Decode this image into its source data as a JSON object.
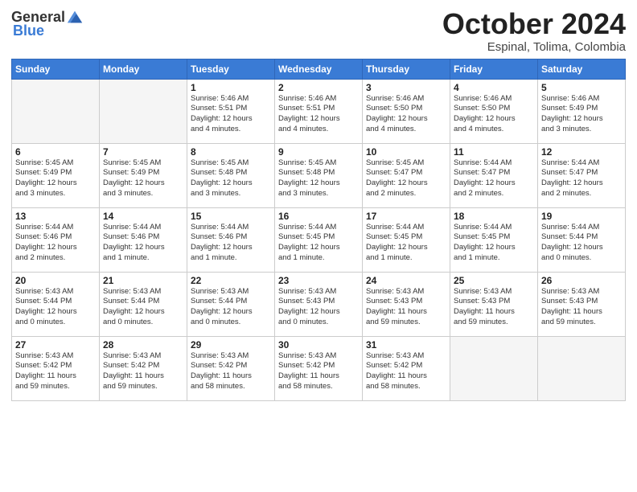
{
  "header": {
    "logo_general": "General",
    "logo_blue": "Blue",
    "month_title": "October 2024",
    "location": "Espinal, Tolima, Colombia"
  },
  "days_of_week": [
    "Sunday",
    "Monday",
    "Tuesday",
    "Wednesday",
    "Thursday",
    "Friday",
    "Saturday"
  ],
  "weeks": [
    [
      {
        "day": "",
        "empty": true,
        "text": ""
      },
      {
        "day": "",
        "empty": true,
        "text": ""
      },
      {
        "day": "1",
        "text": "Sunrise: 5:46 AM\nSunset: 5:51 PM\nDaylight: 12 hours\nand 4 minutes."
      },
      {
        "day": "2",
        "text": "Sunrise: 5:46 AM\nSunset: 5:51 PM\nDaylight: 12 hours\nand 4 minutes."
      },
      {
        "day": "3",
        "text": "Sunrise: 5:46 AM\nSunset: 5:50 PM\nDaylight: 12 hours\nand 4 minutes."
      },
      {
        "day": "4",
        "text": "Sunrise: 5:46 AM\nSunset: 5:50 PM\nDaylight: 12 hours\nand 4 minutes."
      },
      {
        "day": "5",
        "text": "Sunrise: 5:46 AM\nSunset: 5:49 PM\nDaylight: 12 hours\nand 3 minutes."
      }
    ],
    [
      {
        "day": "6",
        "text": "Sunrise: 5:45 AM\nSunset: 5:49 PM\nDaylight: 12 hours\nand 3 minutes."
      },
      {
        "day": "7",
        "text": "Sunrise: 5:45 AM\nSunset: 5:49 PM\nDaylight: 12 hours\nand 3 minutes."
      },
      {
        "day": "8",
        "text": "Sunrise: 5:45 AM\nSunset: 5:48 PM\nDaylight: 12 hours\nand 3 minutes."
      },
      {
        "day": "9",
        "text": "Sunrise: 5:45 AM\nSunset: 5:48 PM\nDaylight: 12 hours\nand 3 minutes."
      },
      {
        "day": "10",
        "text": "Sunrise: 5:45 AM\nSunset: 5:47 PM\nDaylight: 12 hours\nand 2 minutes."
      },
      {
        "day": "11",
        "text": "Sunrise: 5:44 AM\nSunset: 5:47 PM\nDaylight: 12 hours\nand 2 minutes."
      },
      {
        "day": "12",
        "text": "Sunrise: 5:44 AM\nSunset: 5:47 PM\nDaylight: 12 hours\nand 2 minutes."
      }
    ],
    [
      {
        "day": "13",
        "text": "Sunrise: 5:44 AM\nSunset: 5:46 PM\nDaylight: 12 hours\nand 2 minutes."
      },
      {
        "day": "14",
        "text": "Sunrise: 5:44 AM\nSunset: 5:46 PM\nDaylight: 12 hours\nand 1 minute."
      },
      {
        "day": "15",
        "text": "Sunrise: 5:44 AM\nSunset: 5:46 PM\nDaylight: 12 hours\nand 1 minute."
      },
      {
        "day": "16",
        "text": "Sunrise: 5:44 AM\nSunset: 5:45 PM\nDaylight: 12 hours\nand 1 minute."
      },
      {
        "day": "17",
        "text": "Sunrise: 5:44 AM\nSunset: 5:45 PM\nDaylight: 12 hours\nand 1 minute."
      },
      {
        "day": "18",
        "text": "Sunrise: 5:44 AM\nSunset: 5:45 PM\nDaylight: 12 hours\nand 1 minute."
      },
      {
        "day": "19",
        "text": "Sunrise: 5:44 AM\nSunset: 5:44 PM\nDaylight: 12 hours\nand 0 minutes."
      }
    ],
    [
      {
        "day": "20",
        "text": "Sunrise: 5:43 AM\nSunset: 5:44 PM\nDaylight: 12 hours\nand 0 minutes."
      },
      {
        "day": "21",
        "text": "Sunrise: 5:43 AM\nSunset: 5:44 PM\nDaylight: 12 hours\nand 0 minutes."
      },
      {
        "day": "22",
        "text": "Sunrise: 5:43 AM\nSunset: 5:44 PM\nDaylight: 12 hours\nand 0 minutes."
      },
      {
        "day": "23",
        "text": "Sunrise: 5:43 AM\nSunset: 5:43 PM\nDaylight: 12 hours\nand 0 minutes."
      },
      {
        "day": "24",
        "text": "Sunrise: 5:43 AM\nSunset: 5:43 PM\nDaylight: 11 hours\nand 59 minutes."
      },
      {
        "day": "25",
        "text": "Sunrise: 5:43 AM\nSunset: 5:43 PM\nDaylight: 11 hours\nand 59 minutes."
      },
      {
        "day": "26",
        "text": "Sunrise: 5:43 AM\nSunset: 5:43 PM\nDaylight: 11 hours\nand 59 minutes."
      }
    ],
    [
      {
        "day": "27",
        "text": "Sunrise: 5:43 AM\nSunset: 5:42 PM\nDaylight: 11 hours\nand 59 minutes."
      },
      {
        "day": "28",
        "text": "Sunrise: 5:43 AM\nSunset: 5:42 PM\nDaylight: 11 hours\nand 59 minutes."
      },
      {
        "day": "29",
        "text": "Sunrise: 5:43 AM\nSunset: 5:42 PM\nDaylight: 11 hours\nand 58 minutes."
      },
      {
        "day": "30",
        "text": "Sunrise: 5:43 AM\nSunset: 5:42 PM\nDaylight: 11 hours\nand 58 minutes."
      },
      {
        "day": "31",
        "text": "Sunrise: 5:43 AM\nSunset: 5:42 PM\nDaylight: 11 hours\nand 58 minutes."
      },
      {
        "day": "",
        "empty": true,
        "text": ""
      },
      {
        "day": "",
        "empty": true,
        "text": ""
      }
    ]
  ]
}
